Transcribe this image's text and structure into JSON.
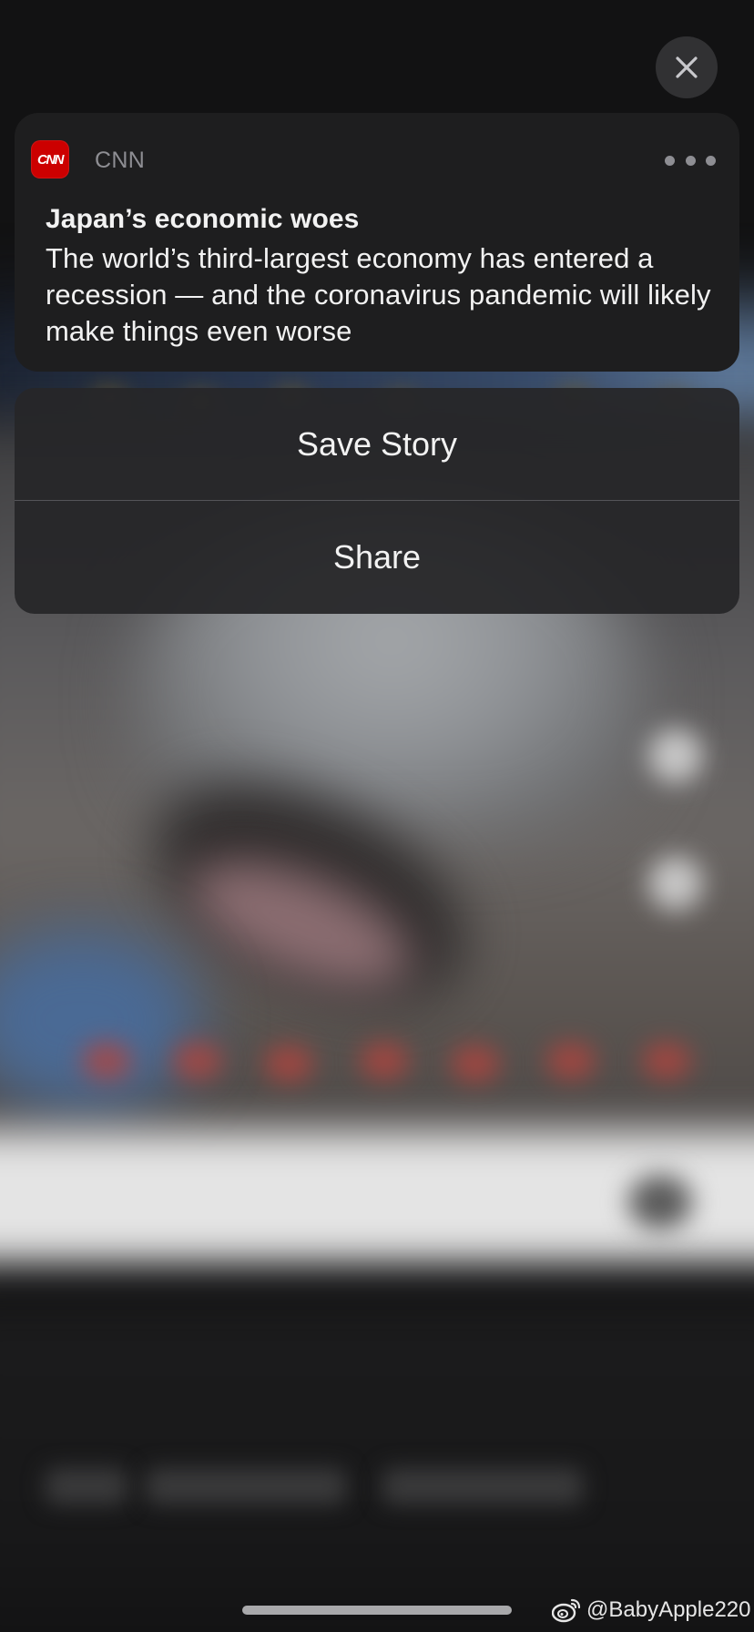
{
  "close_button": {
    "icon": "close-icon"
  },
  "notification": {
    "app_icon_text": "CNN",
    "app_icon_color": "#cc0000",
    "app_name": "CNN",
    "more_icon": "ellipsis-icon",
    "title": "Japan’s economic woes",
    "body": "The world’s third-largest economy has entered a recession — and the coronavirus pandemic will likely make things even worse"
  },
  "actions": [
    {
      "label": "Save Story"
    },
    {
      "label": "Share"
    }
  ],
  "watermark": {
    "logo": "weibo-logo",
    "text": "@BabyApple220"
  }
}
